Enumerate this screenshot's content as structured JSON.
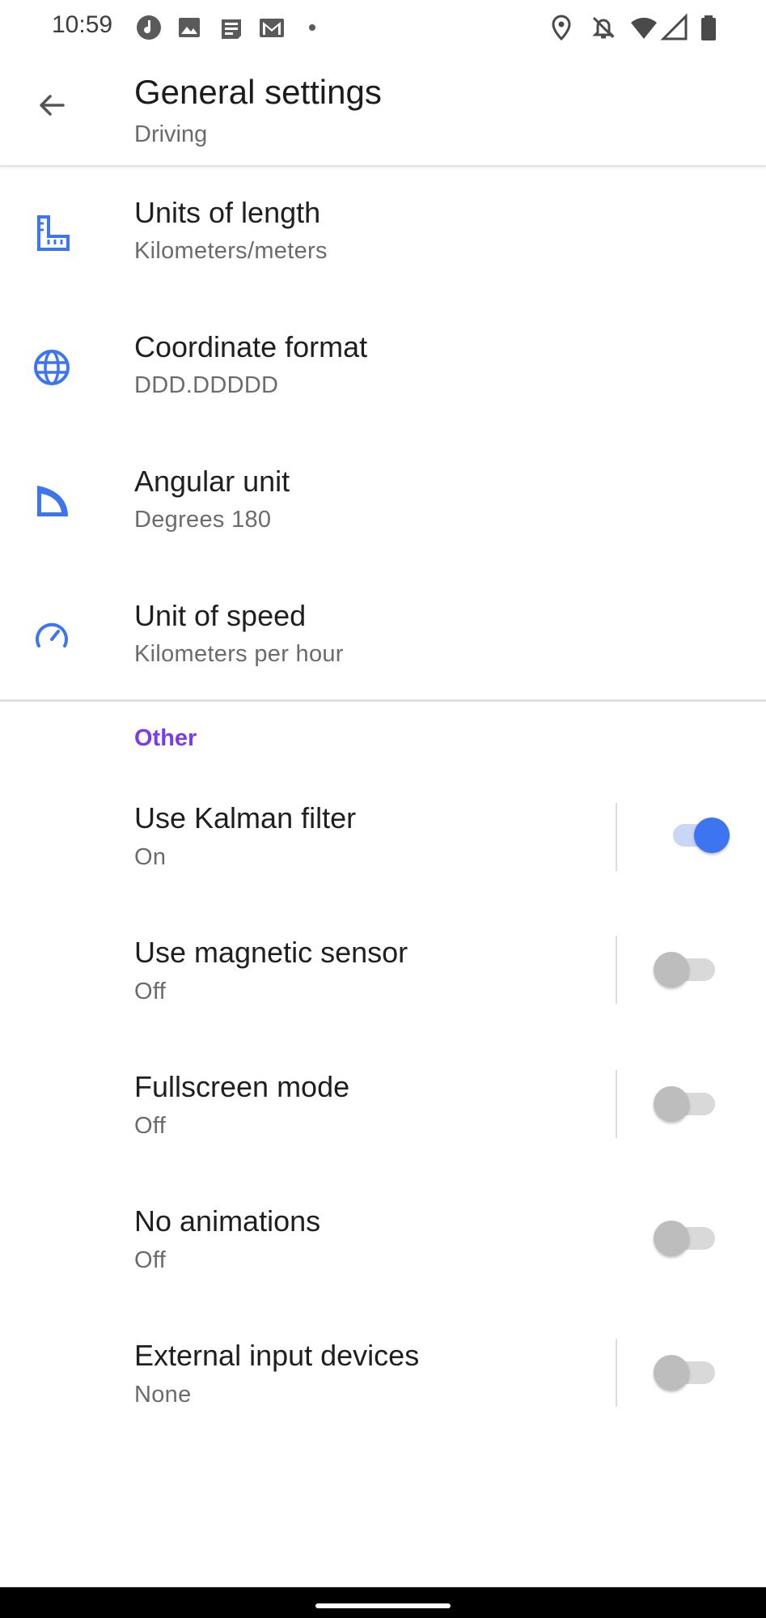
{
  "status_bar": {
    "time": "10:59",
    "left_icons": [
      "music-note-icon",
      "image-icon",
      "news-icon",
      "gmail-icon",
      "dot-icon"
    ],
    "right_icons": [
      "location-icon",
      "bell-off-icon",
      "wifi-icon",
      "signal-icon",
      "battery-icon"
    ]
  },
  "app_bar": {
    "title": "General settings",
    "subtitle": "Driving",
    "back_icon": "arrow-back-icon"
  },
  "units": [
    {
      "title": "Units of length",
      "summary": "Kilometers/meters",
      "icon": "ruler-icon"
    },
    {
      "title": "Coordinate format",
      "summary": "DDD.DDDDD",
      "icon": "globe-icon"
    },
    {
      "title": "Angular unit",
      "summary": "Degrees 180",
      "icon": "angle-icon"
    },
    {
      "title": "Unit of speed",
      "summary": "Kilometers per hour",
      "icon": "speedometer-icon"
    }
  ],
  "other_section": {
    "header": "Other",
    "items": [
      {
        "title": "Use Kalman filter",
        "summary": "On",
        "enabled": true
      },
      {
        "title": "Use magnetic sensor",
        "summary": "Off",
        "enabled": false
      },
      {
        "title": "Fullscreen mode",
        "summary": "Off",
        "enabled": false
      },
      {
        "title": "No animations",
        "summary": "Off",
        "enabled": false
      },
      {
        "title": "External input devices",
        "summary": "None",
        "enabled": false
      }
    ]
  },
  "colors": {
    "accent": "#3d74f0",
    "section_header": "#7c3aed",
    "icon_blue": "#3d74f0"
  }
}
